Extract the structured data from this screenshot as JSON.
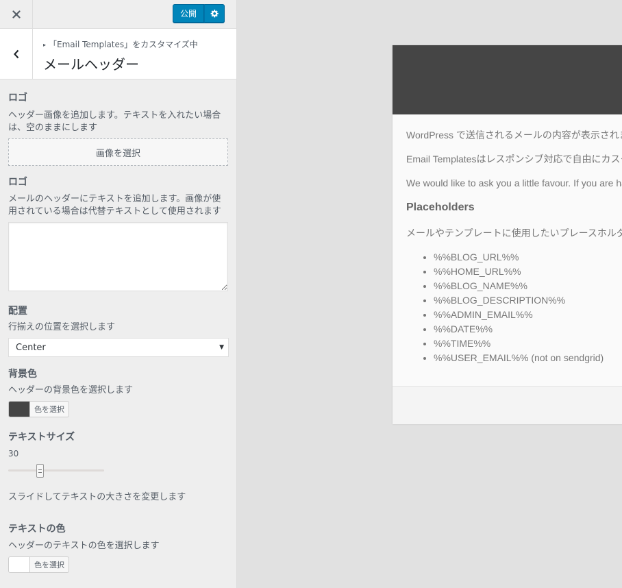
{
  "topbar": {
    "publish_label": "公開"
  },
  "section": {
    "breadcrumb": "「Email Templates」をカスタマイズ中",
    "title": "メールヘッダー"
  },
  "controls": {
    "logo_image": {
      "title": "ロゴ",
      "description": "ヘッダー画像を追加します。テキストを入れたい場合は、空のままにします",
      "button_label": "画像を選択"
    },
    "logo_text": {
      "title": "ロゴ",
      "description": "メールのヘッダーにテキストを追加します。画像が使用されている場合は代替テキストとして使用されます",
      "value": ""
    },
    "alignment": {
      "title": "配置",
      "description": "行揃えの位置を選択します",
      "selected": "Center"
    },
    "bg_color": {
      "title": "背景色",
      "description": "ヘッダーの背景色を選択します",
      "button_label": "色を選択",
      "swatch_color": "#454545"
    },
    "text_size": {
      "title": "テキストサイズ",
      "value": "30",
      "description": "スライドしてテキストの大きさを変更します"
    },
    "text_color": {
      "title": "テキストの色",
      "description": "ヘッダーのテキストの色を選択します",
      "button_label": "色を選択",
      "swatch_color": "#ffffff"
    }
  },
  "preview": {
    "header_color": "#454545",
    "paragraphs": [
      "WordPress で送信されるメールの内容が表示されます。",
      "Email Templatesはレスポンシブ対応で自由にカスタマイズできます。",
      "We would like to ask you a little favour. If you are happy with the plugin"
    ],
    "placeholders_heading": "Placeholders",
    "placeholders_intro": "メールやテンプレートに使用したいプレースホルダー",
    "placeholders": [
      "%%BLOG_URL%%",
      "%%HOME_URL%%",
      "%%BLOG_NAME%%",
      "%%BLOG_DESCRIPTION%%",
      "%%ADMIN_EMAIL%%",
      "%%DATE%%",
      "%%TIME%%",
      "%%USER_EMAIL%% (not on sendgrid)"
    ]
  }
}
